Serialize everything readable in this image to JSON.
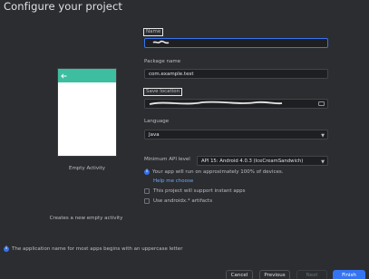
{
  "title": "Configure your project",
  "template": {
    "name": "Empty Activity",
    "description": "Creates a new empty activity",
    "accent": "#3dbea0"
  },
  "name_field": {
    "label": "Name",
    "value": ""
  },
  "package_field": {
    "label": "Package name",
    "value": "com.example.test"
  },
  "save_field": {
    "label": "Save location",
    "value": ""
  },
  "language_field": {
    "label": "Language",
    "value": "Java"
  },
  "api_field": {
    "label": "Minimum API level",
    "value": "API 15: Android 4.0.3 (IceCreamSandwich)"
  },
  "api_info": "Your app will run on approximately 100% of devices.",
  "help_link": "Help me choose",
  "instant_apps": "This project will support instant apps",
  "androidx": "Use androidx.* artifacts",
  "footer_info": "The application name for most apps begins with an uppercase letter",
  "buttons": {
    "cancel": "Cancel",
    "previous": "Previous",
    "next": "Next",
    "finish": "Finish"
  },
  "colors": {
    "primary": "#3574f0",
    "background": "#2b2d30",
    "link": "#6fa8ff"
  }
}
